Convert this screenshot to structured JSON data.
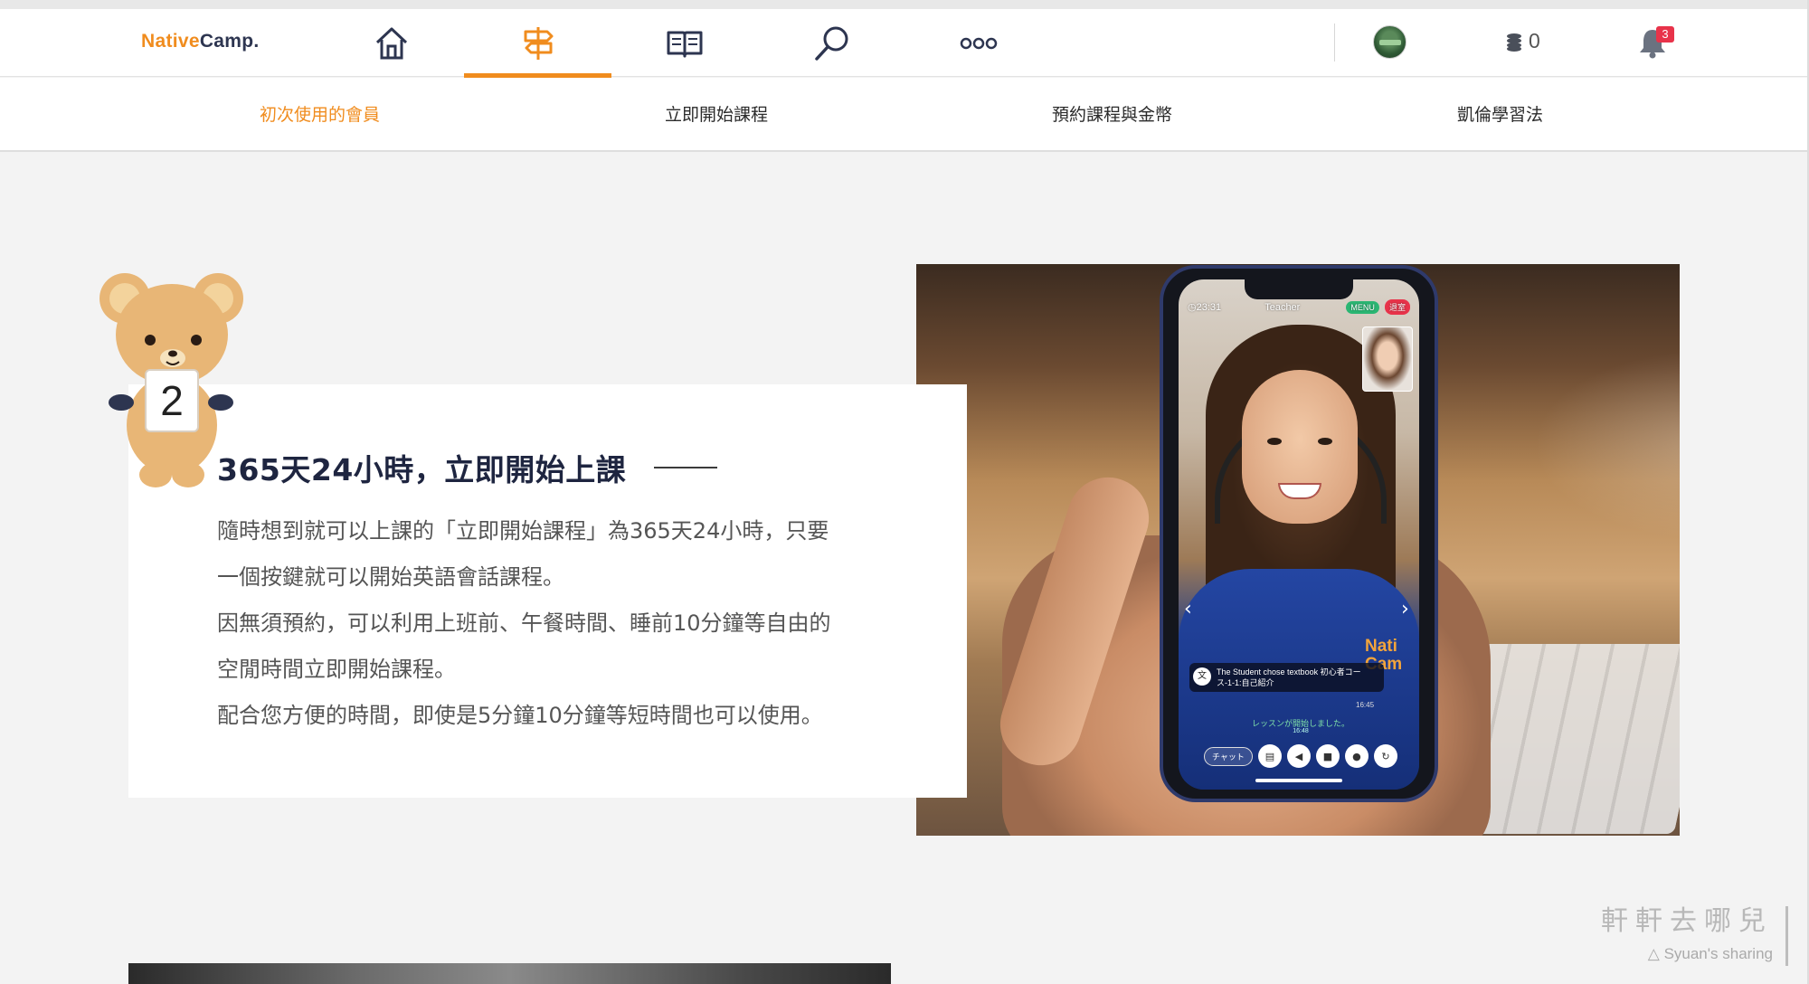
{
  "header": {
    "logo": {
      "native": "Native",
      "camp": "Camp."
    },
    "nav_icons": [
      "home-icon",
      "signpost-icon",
      "book-icon",
      "search-icon",
      "more-icon"
    ],
    "active_nav_icon": "signpost-icon",
    "coins": "0",
    "notifications_count": "3"
  },
  "subnav": {
    "items": [
      "初次使用的會員",
      "立即開始課程",
      "預約課程與金幣",
      "凱倫學習法"
    ],
    "active_index": 0
  },
  "section": {
    "step_number": "2",
    "title": "365天24小時，立即開始上課",
    "paragraphs": [
      "隨時想到就可以上課的「立即開始課程」為365天24小時，只要",
      "一個按鍵就可以開始英語會話課程。",
      "因無須預約，可以利用上班前、午餐時間、睡前10分鐘等自由的",
      "空閒時間立即開始課程。",
      "配合您方便的時間，即使是5分鐘10分鐘等短時間也可以使用。"
    ]
  },
  "phone_ui": {
    "timer": "23:31",
    "role": "Teacher",
    "menu_label": "MENU",
    "exit_label": "退室",
    "shirt_brand": [
      "Nati",
      "Cam"
    ],
    "chat_message": "The Student chose textbook 初心者コース-1-1:自己紹介",
    "chat_time": "16:45",
    "system_message": "レッスンが開始しました。",
    "system_time": "16:48",
    "chat_button": "チャット",
    "control_icons": [
      "textbook-icon",
      "volume-icon",
      "camera-icon",
      "mic-icon",
      "refresh-icon"
    ]
  },
  "watermark": {
    "chinese": "軒軒去哪兒",
    "english": "Syuan's sharing"
  },
  "colors": {
    "accent": "#f08c1e",
    "title": "#1e2540",
    "body_text": "#555555",
    "page_bg": "#f3f3f3",
    "badge": "#e8334a"
  }
}
